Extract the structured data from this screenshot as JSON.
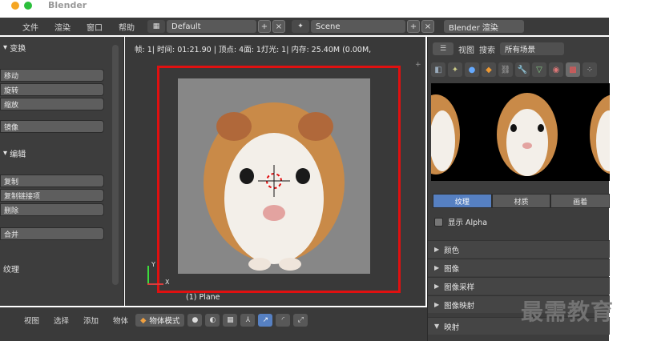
{
  "app": {
    "title": "Blender"
  },
  "colors": {
    "accent": "#5680c2",
    "frame": "#e01010",
    "axis_y": "#3ddb3d",
    "axis_x": "#db3d3d"
  },
  "header": {
    "menus": [
      "文件",
      "渲染",
      "窗口",
      "帮助"
    ],
    "layout": "Default",
    "scene": "Scene",
    "engine": "Blender 渲染"
  },
  "toolshelf": {
    "transform_title": "变换",
    "transform_tools": [
      "移动",
      "旋转",
      "缩放"
    ],
    "mirror": "镜像",
    "edit_title": "编辑",
    "edit_tools": [
      "复制",
      "复制链接项",
      "删除"
    ],
    "join": "合并",
    "texture_title": "纹理"
  },
  "viewport": {
    "info": "帧: 1| 时间: 01:21.90 | 顶点: 4面: 1灯光: 1| 内存: 25.40M (0.00M,",
    "axis_y_label": "Y",
    "axis_x_label": "X",
    "object_name": "(1) Plane"
  },
  "props": {
    "view_label": "视图",
    "search_label": "搜索",
    "scope": "所有场景",
    "tabs": [
      "纹理",
      "材质",
      "画着"
    ],
    "show_alpha": "显示 Alpha",
    "sections": [
      "颜色",
      "图像",
      "图像采样",
      "图像映射",
      "映射"
    ]
  },
  "footer": {
    "menus": [
      "视图",
      "选择",
      "添加",
      "物体"
    ],
    "mode": "物体模式"
  },
  "watermark": "最需教育"
}
